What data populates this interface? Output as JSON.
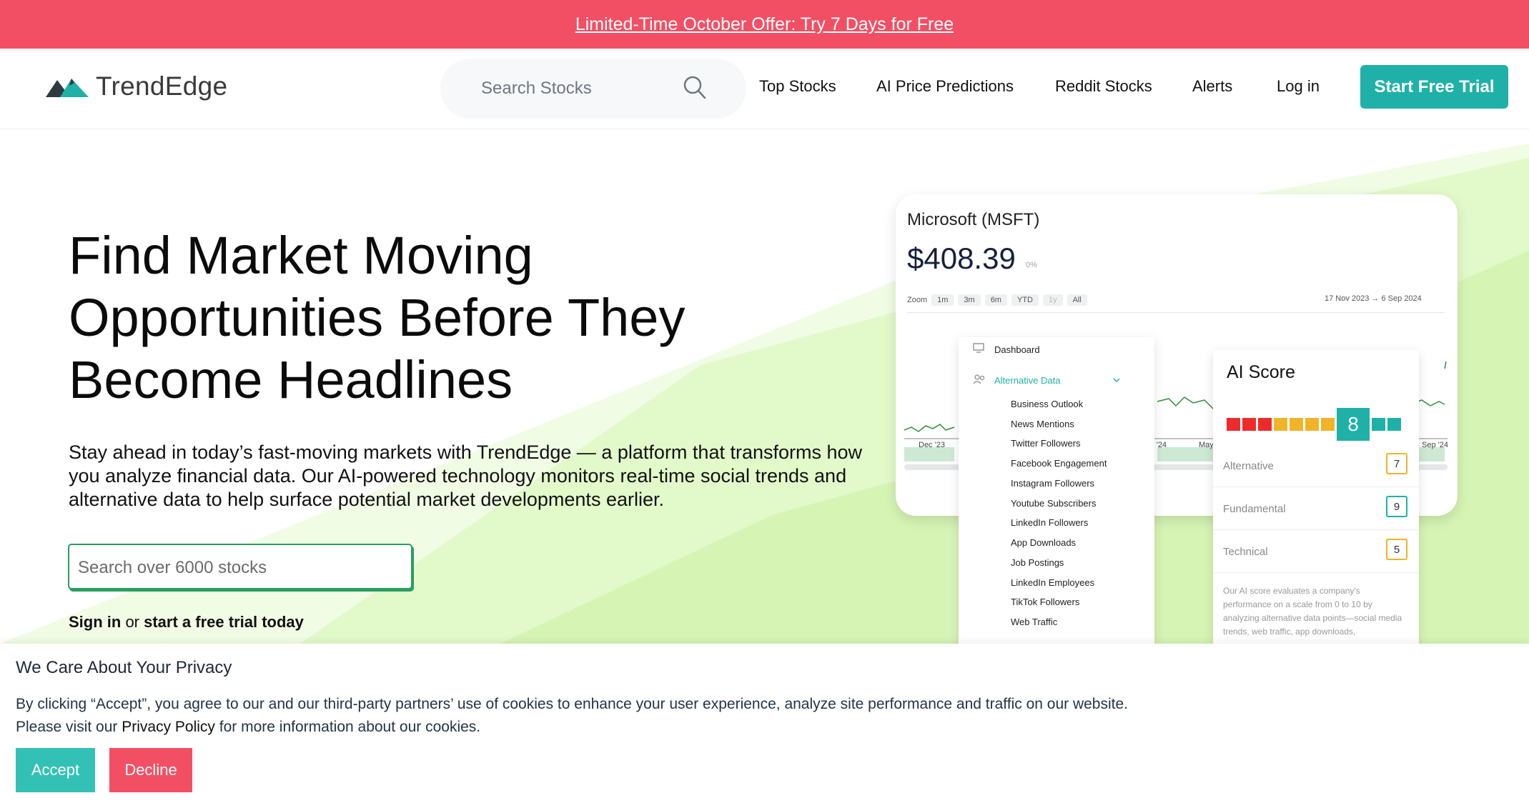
{
  "promo": {
    "text": "Limited-Time October Offer: Try 7 Days for Free"
  },
  "header": {
    "logo_text": "TrendEdge",
    "search_placeholder": "Search Stocks",
    "nav": [
      "Top Stocks",
      "AI Price Predictions",
      "Reddit Stocks",
      "Alerts",
      "Log in"
    ],
    "cta": "Start Free Trial"
  },
  "hero": {
    "title_lines": [
      "Find Market Moving",
      "Opportunities Before They",
      "Become Headlines"
    ],
    "subtitle": "Stay ahead in today’s fast-moving markets with TrendEdge — a platform that transforms how you analyze financial data. Our AI-powered technology monitors real-time social trends and alternative data to help surface potential market developments earlier.",
    "search_placeholder": "Search over 6000 stocks",
    "signin": "Sign in",
    "or": " or ",
    "trial": "start a free trial today"
  },
  "card": {
    "title": "Microsoft (MSFT)",
    "price": "$408.39",
    "change": "0%",
    "zoom_label": "Zoom",
    "zoom": [
      "1m",
      "3m",
      "6m",
      "YTD",
      "1y",
      "All"
    ],
    "range": "17 Nov 2023 → 6 Sep 2024",
    "axis": [
      "Dec '23",
      "r '24",
      "May",
      "Sep '24"
    ]
  },
  "menu": {
    "dashboard": "Dashboard",
    "alternative": "Alternative Data",
    "items": [
      "Business Outlook",
      "News Mentions",
      "Twitter Followers",
      "Facebook Engagement",
      "Instagram Followers",
      "Youtube Subscribers",
      "LinkedIn Followers",
      "App Downloads",
      "Job Postings",
      "LinkedIn Employees",
      "TikTok Followers",
      "Web Traffic"
    ]
  },
  "ai_score": {
    "title": "AI Score",
    "score": "8",
    "rows": [
      {
        "label": "Alternative",
        "value": "7",
        "color": "#f0b429"
      },
      {
        "label": "Fundamental",
        "value": "9",
        "color": "#1fb1a8"
      },
      {
        "label": "Technical",
        "value": "5",
        "color": "#f0b429"
      }
    ],
    "description": "Our AI score evaluates a company's performance on a scale from 0 to 10 by analyzing alternative data points—social media trends, web traffic, app downloads,"
  },
  "cookie": {
    "title": "We Care About Your Privacy",
    "body_1": "By clicking “Accept”, you agree to our and our third-party partners’ use of cookies to enhance your user experience, analyze site performance and traffic on our website.",
    "body_2a": "Please visit our ",
    "privacy_link": "Privacy Policy",
    "body_2b": " for more information about our cookies.",
    "accept": "Accept",
    "decline": "Decline"
  },
  "colors": {
    "brand": "#1fb1a8",
    "promo": "#f34f64",
    "hero_green": "#d9f6b8"
  }
}
